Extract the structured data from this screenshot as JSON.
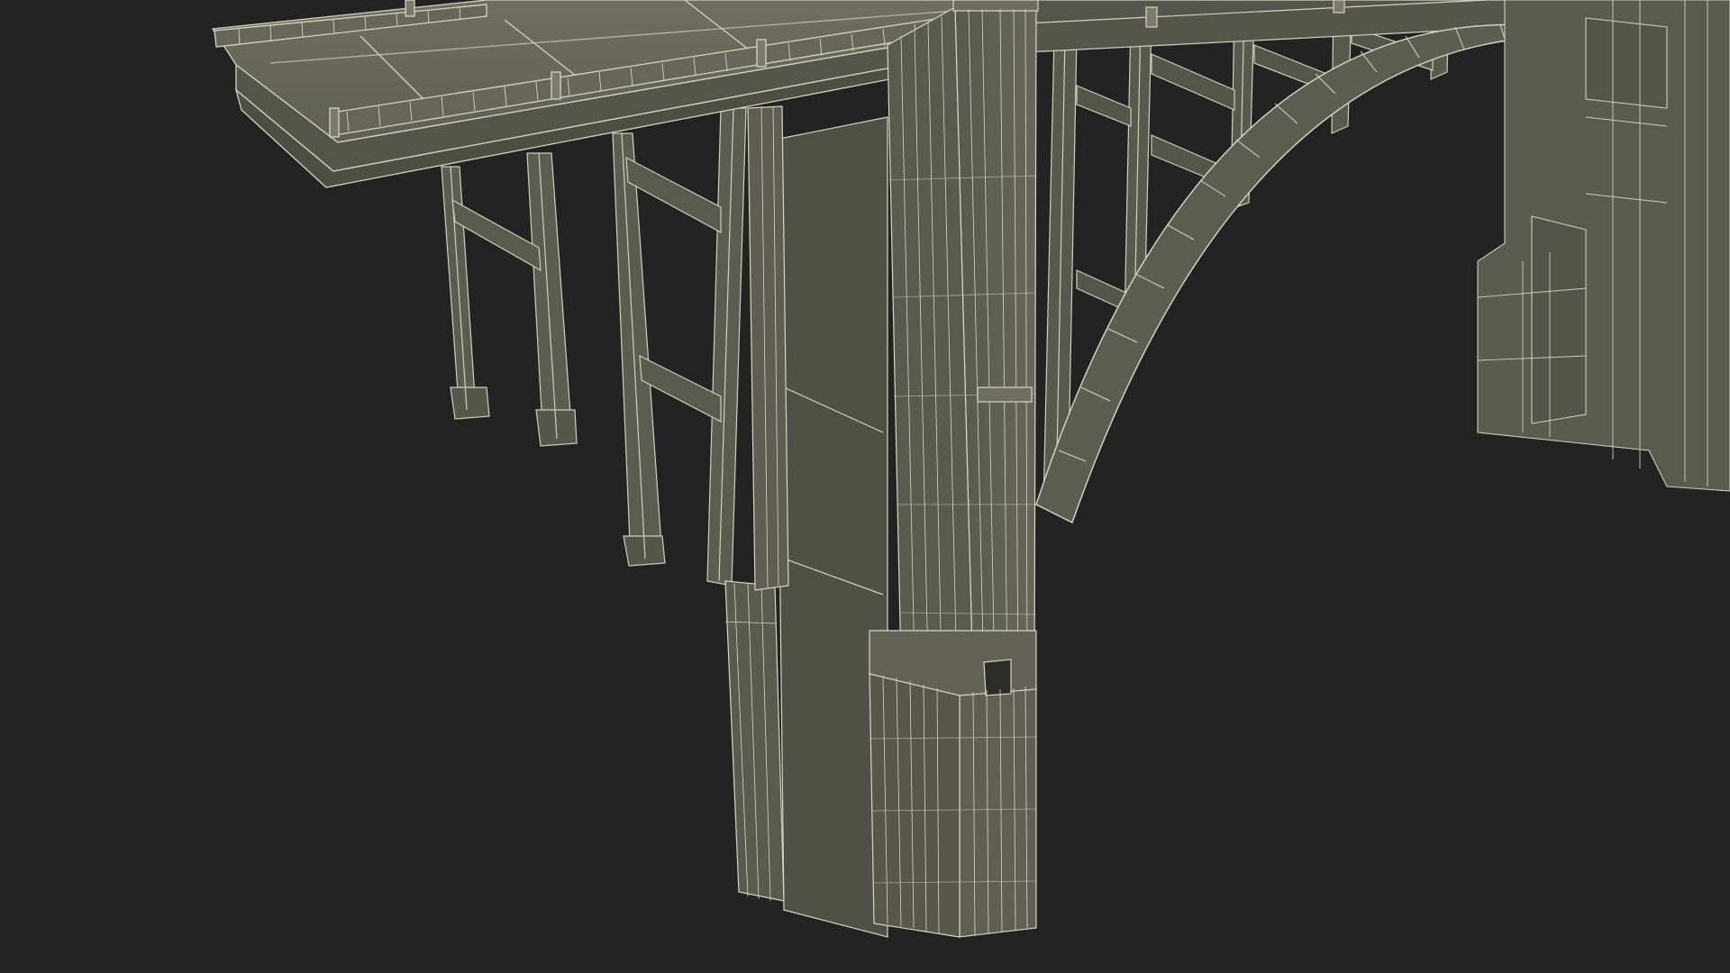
{
  "scene": {
    "subject": "bridge-wireframe-render",
    "colors": {
      "background": "#232323",
      "surface": "#5e5f52",
      "surface_dark": "#4f5045",
      "surface_light": "#6b6c5e",
      "wire": "#d8d8c4",
      "wire_dim": "#a9aa98"
    }
  }
}
